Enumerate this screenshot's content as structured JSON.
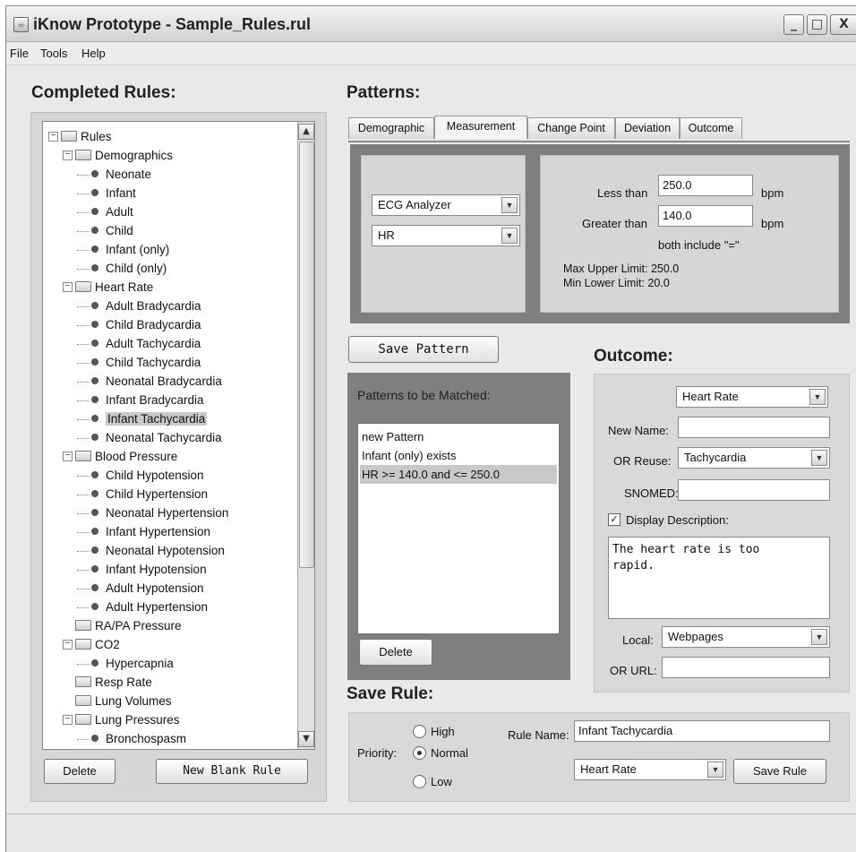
{
  "window": {
    "title": "iKnow Prototype - Sample_Rules.rul",
    "controls": {
      "minimize": "_",
      "maximize": "□",
      "close": "X"
    }
  },
  "menu": [
    "File",
    "Tools",
    "Help"
  ],
  "completed_rules": {
    "title": "Completed Rules:",
    "tree": [
      {
        "label": "Rules",
        "type": "folder",
        "expanded": true
      },
      {
        "label": "Demographics",
        "type": "folder",
        "expanded": true
      },
      {
        "label": "Neonate",
        "type": "leaf"
      },
      {
        "label": "Infant",
        "type": "leaf"
      },
      {
        "label": "Adult",
        "type": "leaf"
      },
      {
        "label": "Child",
        "type": "leaf"
      },
      {
        "label": "Infant (only)",
        "type": "leaf"
      },
      {
        "label": "Child (only)",
        "type": "leaf"
      },
      {
        "label": "Heart Rate",
        "type": "folder",
        "expanded": true
      },
      {
        "label": "Adult Bradycardia",
        "type": "leaf"
      },
      {
        "label": "Child Bradycardia",
        "type": "leaf"
      },
      {
        "label": "Adult Tachycardia",
        "type": "leaf"
      },
      {
        "label": "Child Tachycardia",
        "type": "leaf"
      },
      {
        "label": "Neonatal Bradycardia",
        "type": "leaf"
      },
      {
        "label": "Infant Bradycardia",
        "type": "leaf"
      },
      {
        "label": "Infant Tachycardia",
        "type": "leaf",
        "selected": true
      },
      {
        "label": "Neonatal Tachycardia",
        "type": "leaf"
      },
      {
        "label": "Blood Pressure",
        "type": "folder",
        "expanded": true
      },
      {
        "label": "Child Hypotension",
        "type": "leaf"
      },
      {
        "label": "Child Hypertension",
        "type": "leaf"
      },
      {
        "label": "Neonatal Hypertension",
        "type": "leaf"
      },
      {
        "label": "Infant Hypertension",
        "type": "leaf"
      },
      {
        "label": "Neonatal Hypotension",
        "type": "leaf"
      },
      {
        "label": "Infant Hypotension",
        "type": "leaf"
      },
      {
        "label": "Adult Hypotension",
        "type": "leaf"
      },
      {
        "label": "Adult Hypertension",
        "type": "leaf"
      },
      {
        "label": "RA/PA Pressure",
        "type": "folder",
        "expanded": false
      },
      {
        "label": "CO2",
        "type": "folder",
        "expanded": true
      },
      {
        "label": "Hypercapnia",
        "type": "leaf"
      },
      {
        "label": "Resp Rate",
        "type": "folder",
        "expanded": false
      },
      {
        "label": "Lung Volumes",
        "type": "folder",
        "expanded": false
      },
      {
        "label": "Lung Pressures",
        "type": "folder",
        "expanded": true
      },
      {
        "label": "Bronchospasm",
        "type": "leaf"
      }
    ],
    "delete_label": "Delete",
    "new_blank_label": "New Blank Rule"
  },
  "patterns": {
    "title": "Patterns:",
    "tabs": [
      "Demographic",
      "Measurement",
      "Change Point",
      "Deviation",
      "Outcome"
    ],
    "active_tab": 1,
    "source_select": "ECG Analyzer",
    "measure_select": "HR",
    "less_than_label": "Less than",
    "less_than_value": "250.0",
    "greater_than_label": "Greater than",
    "greater_than_value": "140.0",
    "unit": "bpm",
    "both_include": "both include \"=\"",
    "max_upper": "Max Upper Limit: 250.0",
    "min_lower": "Min Lower Limit: 20.0",
    "save_pattern_label": "Save Pattern",
    "to_match_title": "Patterns to be Matched:",
    "to_match": [
      "new Pattern",
      "Infant (only) exists",
      "HR >= 140.0 and <= 250.0"
    ],
    "to_match_selected": 2,
    "delete_label": "Delete"
  },
  "outcome": {
    "title": "Outcome:",
    "category_select": "Heart Rate",
    "new_name_label": "New Name:",
    "new_name_value": "",
    "reuse_label": "OR Reuse:",
    "reuse_select": "Tachycardia",
    "snomed_label": "SNOMED:",
    "snomed_value": "",
    "display_desc_label": "Display Description:",
    "display_desc_checked": true,
    "description": "The heart rate is too\nrapid.",
    "local_label": "Local:",
    "local_select": "Webpages",
    "url_label": "OR URL:",
    "url_value": ""
  },
  "save_rule": {
    "title": "Save Rule:",
    "priority_label": "Priority:",
    "priorities": [
      "High",
      "Normal",
      "Low"
    ],
    "priority_selected": 1,
    "rule_name_label": "Rule Name:",
    "rule_name_value": "Infant Tachycardia",
    "category_select": "Heart Rate",
    "save_label": "Save Rule"
  }
}
